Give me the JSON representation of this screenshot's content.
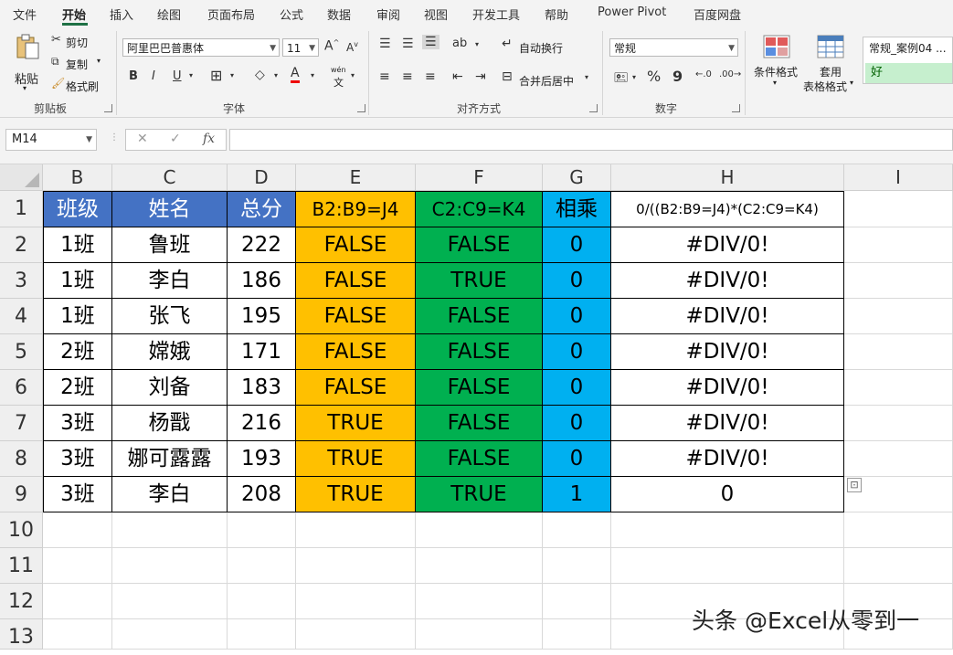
{
  "menu": {
    "tabs": [
      "文件",
      "开始",
      "插入",
      "绘图",
      "页面布局",
      "公式",
      "数据",
      "审阅",
      "视图",
      "开发工具",
      "帮助",
      "Power Pivot",
      "百度网盘"
    ],
    "active_tab": "开始"
  },
  "ribbon": {
    "clipboard": {
      "label": "剪贴板",
      "paste": "粘贴",
      "cut": "剪切",
      "copy": "复制",
      "format_painter": "格式刷"
    },
    "font": {
      "label": "字体",
      "font_name": "阿里巴巴普惠体",
      "font_size": "11",
      "bold": "B",
      "italic": "I",
      "underline": "U",
      "grow": "A",
      "shrink": "A",
      "wen": "wén",
      "wen_zi": "文"
    },
    "alignment": {
      "label": "对齐方式",
      "wrap": "自动换行",
      "merge": "合并后居中"
    },
    "number": {
      "label": "数字",
      "format": "常规",
      "percent": "%",
      "comma": "9"
    },
    "styles": {
      "conditional": "条件格式",
      "table_line1": "套用",
      "table_line2": "表格格式",
      "normal": "常规_案例04 ...",
      "good": "好"
    }
  },
  "formula_bar": {
    "name_box": "M14",
    "cancel": "✕",
    "enter": "✓",
    "fx": "fx",
    "formula": ""
  },
  "sheet": {
    "columns": [
      "B",
      "C",
      "D",
      "E",
      "F",
      "G",
      "H",
      "I"
    ],
    "rows": [
      "1",
      "2",
      "3",
      "4",
      "5",
      "6",
      "7",
      "8",
      "9",
      "10",
      "11",
      "12",
      "13"
    ],
    "header": [
      "班级",
      "姓名",
      "总分",
      "B2:B9=J4",
      "C2:C9=K4",
      "相乘",
      "0/((B2:B9=J4)*(C2:C9=K4)"
    ],
    "data": [
      [
        "1班",
        "鲁班",
        "222",
        "FALSE",
        "FALSE",
        "0",
        "#DIV/0!"
      ],
      [
        "1班",
        "李白",
        "186",
        "FALSE",
        "TRUE",
        "0",
        "#DIV/0!"
      ],
      [
        "1班",
        "张飞",
        "195",
        "FALSE",
        "FALSE",
        "0",
        "#DIV/0!"
      ],
      [
        "2班",
        "嫦娥",
        "171",
        "FALSE",
        "FALSE",
        "0",
        "#DIV/0!"
      ],
      [
        "2班",
        "刘备",
        "183",
        "FALSE",
        "FALSE",
        "0",
        "#DIV/0!"
      ],
      [
        "3班",
        "杨戬",
        "216",
        "TRUE",
        "FALSE",
        "0",
        "#DIV/0!"
      ],
      [
        "3班",
        "娜可露露",
        "193",
        "TRUE",
        "FALSE",
        "0",
        "#DIV/0!"
      ],
      [
        "3班",
        "李白",
        "208",
        "TRUE",
        "TRUE",
        "1",
        "0"
      ]
    ]
  },
  "colors": {
    "header_blue": "#4472c4",
    "yellow": "#ffc000",
    "green": "#00b050",
    "sky": "#00b0f0",
    "accent": "#1e7145"
  },
  "watermark": "头条 @Excel从零到一"
}
